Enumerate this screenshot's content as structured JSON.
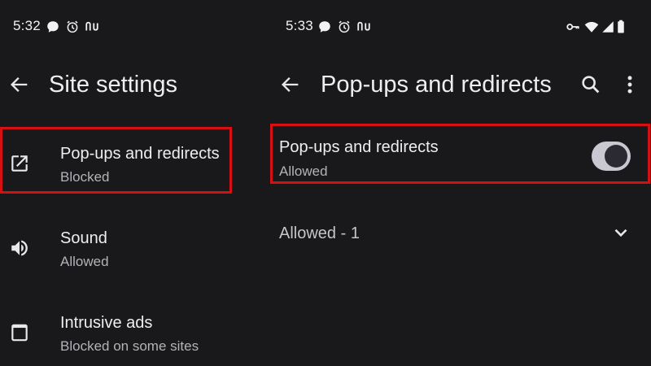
{
  "left_screen": {
    "status_bar": {
      "time": "5:32",
      "icons": [
        "chat-bubble-icon",
        "alarm-icon",
        "nu-icon"
      ]
    },
    "header": {
      "back_icon": "back-arrow-icon",
      "title": "Site settings"
    },
    "items": [
      {
        "icon": "open-in-new-icon",
        "title": "Pop-ups and redirects",
        "subtitle": "Blocked",
        "highlighted": true
      },
      {
        "icon": "volume-icon",
        "title": "Sound",
        "subtitle": "Allowed",
        "highlighted": false
      },
      {
        "icon": "square-icon",
        "title": "Intrusive ads",
        "subtitle": "Blocked on some sites",
        "highlighted": false
      }
    ]
  },
  "right_screen": {
    "status_bar": {
      "time": "5:33",
      "icons": [
        "chat-bubble-icon",
        "alarm-icon",
        "nu-icon"
      ],
      "right_icons": [
        "key-icon",
        "wifi-icon",
        "signal-icon",
        "battery-icon"
      ]
    },
    "header": {
      "back_icon": "back-arrow-icon",
      "title": "Pop-ups and redirects",
      "actions": [
        "search-icon",
        "more-vert-icon"
      ]
    },
    "setting": {
      "title": "Pop-ups and redirects",
      "subtitle": "Allowed",
      "toggle_on": true,
      "highlighted": true
    },
    "section": {
      "label": "Allowed - 1",
      "icon": "chevron-down-icon"
    }
  },
  "colors": {
    "background": "#19191b",
    "highlight_border": "#d60f12",
    "toggle_track": "#c9c7d2",
    "toggle_knob": "#2b2a33"
  }
}
